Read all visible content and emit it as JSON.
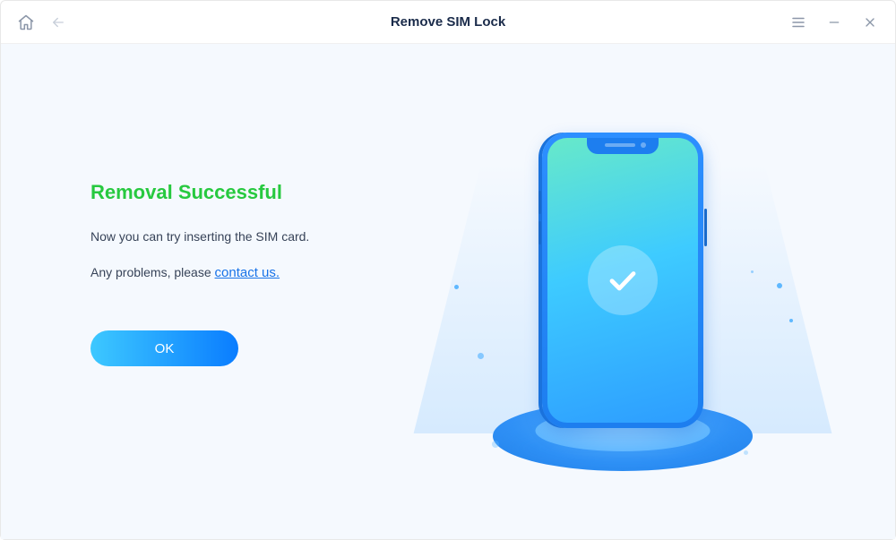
{
  "titlebar": {
    "title": "Remove SIM Lock"
  },
  "content": {
    "heading": "Removal Successful",
    "message": "Now you can try inserting the SIM card.",
    "help_prefix": "Any problems, please ",
    "help_link": "contact us.",
    "ok_label": "OK"
  }
}
